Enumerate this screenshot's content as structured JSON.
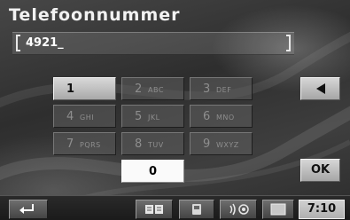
{
  "header": {
    "title": "Telefoonnummer"
  },
  "entry": {
    "value": "4921_"
  },
  "keypad": {
    "keys": [
      {
        "digit": "1",
        "letters": ""
      },
      {
        "digit": "2",
        "letters": "ABC"
      },
      {
        "digit": "3",
        "letters": "DEF"
      },
      {
        "digit": "4",
        "letters": "GHI"
      },
      {
        "digit": "5",
        "letters": "JKL"
      },
      {
        "digit": "6",
        "letters": "MNO"
      },
      {
        "digit": "7",
        "letters": "PQRS"
      },
      {
        "digit": "8",
        "letters": "TUV"
      },
      {
        "digit": "9",
        "letters": "WXYZ"
      },
      {
        "digit": "0",
        "letters": ""
      }
    ]
  },
  "controls": {
    "ok_label": "OK"
  },
  "status": {
    "clock": "7:10"
  }
}
